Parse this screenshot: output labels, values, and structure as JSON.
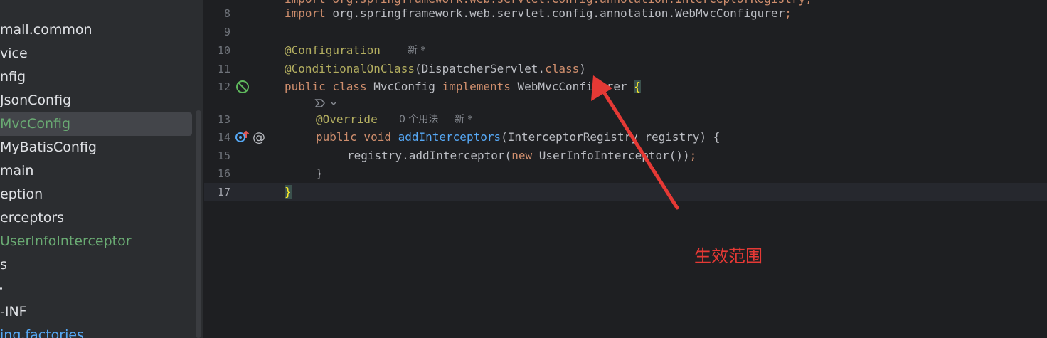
{
  "project_tree": {
    "items": [
      {
        "label": "mall.common",
        "state": "normal"
      },
      {
        "label": "vice",
        "state": "normal"
      },
      {
        "label": "nfig",
        "state": "normal"
      },
      {
        "label": "JsonConfig",
        "state": "normal"
      },
      {
        "label": "MvcConfig",
        "state": "selected"
      },
      {
        "label": "MyBatisConfig",
        "state": "normal"
      },
      {
        "label": "main",
        "state": "normal"
      },
      {
        "label": "eption",
        "state": "normal"
      },
      {
        "label": "erceptors",
        "state": "normal"
      },
      {
        "label": "UserInfoInterceptor",
        "state": "green"
      },
      {
        "label": "s",
        "state": "normal"
      },
      {
        "label": "-INF",
        "state": "normal"
      },
      {
        "label": "ing.factories",
        "state": "link"
      }
    ]
  },
  "editor": {
    "line_numbers": [
      "8",
      "9",
      "10",
      "11",
      "12",
      "13",
      "14",
      "15",
      "16",
      "17"
    ],
    "current_line": "17",
    "code": {
      "line7_partial": "import org.springframework.web.servlet.config.annotation.InterceptorRegistry;",
      "line8_import": "import",
      "line8_rest": " org.springframework.web.servlet.config.annotation.WebMvcConfigurer",
      "line8_semi": ";",
      "line10_ann": "@Configuration",
      "line11_ann": "@ConditionalOnClass",
      "line11_mid": "(DispatcherServlet.",
      "line11_kw": "class",
      "line11_end": ")",
      "line12_kw1": "public class",
      "line12_name": " MvcConfig ",
      "line12_kw2": "implements",
      "line12_iface": " WebMvcConfigurer ",
      "line12_brace": "{",
      "line13_ann": "@Override",
      "line14_kw": "public void",
      "line14_fn": "addInterceptors",
      "line14_rest": "(InterceptorRegistry registry) {",
      "line15_a": "registry.addInterceptor(",
      "line15_kw": "new",
      "line15_b": " UserInfoInterceptor())",
      "line15_semi": ";",
      "line16": "}",
      "line17": "}"
    },
    "hints": {
      "line10_new": "新 *",
      "line13_usages": "0 个用法",
      "line13_new": "新 *"
    }
  },
  "annotation_text": "生效范围",
  "colors": {
    "background": "#1e1f22",
    "keyword": "#cf8e6d",
    "annotation": "#b3ae60",
    "function": "#56a8f5",
    "arrow": "#e53935"
  }
}
